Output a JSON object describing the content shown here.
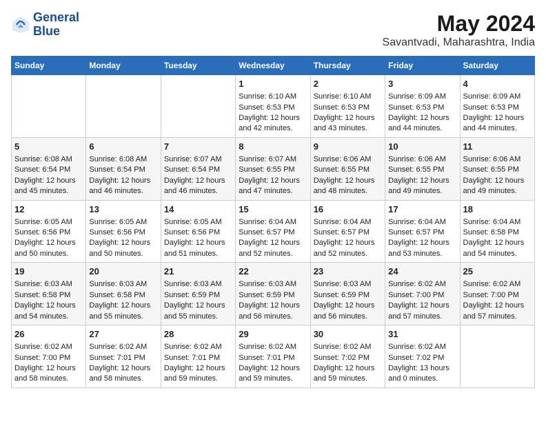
{
  "header": {
    "logo_line1": "General",
    "logo_line2": "Blue",
    "title": "May 2024",
    "subtitle": "Savantvadi, Maharashtra, India"
  },
  "weekdays": [
    "Sunday",
    "Monday",
    "Tuesday",
    "Wednesday",
    "Thursday",
    "Friday",
    "Saturday"
  ],
  "weeks": [
    [
      {
        "day": "",
        "data": ""
      },
      {
        "day": "",
        "data": ""
      },
      {
        "day": "",
        "data": ""
      },
      {
        "day": "1",
        "data": "Sunrise: 6:10 AM\nSunset: 6:53 PM\nDaylight: 12 hours and 42 minutes."
      },
      {
        "day": "2",
        "data": "Sunrise: 6:10 AM\nSunset: 6:53 PM\nDaylight: 12 hours and 43 minutes."
      },
      {
        "day": "3",
        "data": "Sunrise: 6:09 AM\nSunset: 6:53 PM\nDaylight: 12 hours and 44 minutes."
      },
      {
        "day": "4",
        "data": "Sunrise: 6:09 AM\nSunset: 6:53 PM\nDaylight: 12 hours and 44 minutes."
      }
    ],
    [
      {
        "day": "5",
        "data": "Sunrise: 6:08 AM\nSunset: 6:54 PM\nDaylight: 12 hours and 45 minutes."
      },
      {
        "day": "6",
        "data": "Sunrise: 6:08 AM\nSunset: 6:54 PM\nDaylight: 12 hours and 46 minutes."
      },
      {
        "day": "7",
        "data": "Sunrise: 6:07 AM\nSunset: 6:54 PM\nDaylight: 12 hours and 46 minutes."
      },
      {
        "day": "8",
        "data": "Sunrise: 6:07 AM\nSunset: 6:55 PM\nDaylight: 12 hours and 47 minutes."
      },
      {
        "day": "9",
        "data": "Sunrise: 6:06 AM\nSunset: 6:55 PM\nDaylight: 12 hours and 48 minutes."
      },
      {
        "day": "10",
        "data": "Sunrise: 6:06 AM\nSunset: 6:55 PM\nDaylight: 12 hours and 49 minutes."
      },
      {
        "day": "11",
        "data": "Sunrise: 6:06 AM\nSunset: 6:55 PM\nDaylight: 12 hours and 49 minutes."
      }
    ],
    [
      {
        "day": "12",
        "data": "Sunrise: 6:05 AM\nSunset: 6:56 PM\nDaylight: 12 hours and 50 minutes."
      },
      {
        "day": "13",
        "data": "Sunrise: 6:05 AM\nSunset: 6:56 PM\nDaylight: 12 hours and 50 minutes."
      },
      {
        "day": "14",
        "data": "Sunrise: 6:05 AM\nSunset: 6:56 PM\nDaylight: 12 hours and 51 minutes."
      },
      {
        "day": "15",
        "data": "Sunrise: 6:04 AM\nSunset: 6:57 PM\nDaylight: 12 hours and 52 minutes."
      },
      {
        "day": "16",
        "data": "Sunrise: 6:04 AM\nSunset: 6:57 PM\nDaylight: 12 hours and 52 minutes."
      },
      {
        "day": "17",
        "data": "Sunrise: 6:04 AM\nSunset: 6:57 PM\nDaylight: 12 hours and 53 minutes."
      },
      {
        "day": "18",
        "data": "Sunrise: 6:04 AM\nSunset: 6:58 PM\nDaylight: 12 hours and 54 minutes."
      }
    ],
    [
      {
        "day": "19",
        "data": "Sunrise: 6:03 AM\nSunset: 6:58 PM\nDaylight: 12 hours and 54 minutes."
      },
      {
        "day": "20",
        "data": "Sunrise: 6:03 AM\nSunset: 6:58 PM\nDaylight: 12 hours and 55 minutes."
      },
      {
        "day": "21",
        "data": "Sunrise: 6:03 AM\nSunset: 6:59 PM\nDaylight: 12 hours and 55 minutes."
      },
      {
        "day": "22",
        "data": "Sunrise: 6:03 AM\nSunset: 6:59 PM\nDaylight: 12 hours and 56 minutes."
      },
      {
        "day": "23",
        "data": "Sunrise: 6:03 AM\nSunset: 6:59 PM\nDaylight: 12 hours and 56 minutes."
      },
      {
        "day": "24",
        "data": "Sunrise: 6:02 AM\nSunset: 7:00 PM\nDaylight: 12 hours and 57 minutes."
      },
      {
        "day": "25",
        "data": "Sunrise: 6:02 AM\nSunset: 7:00 PM\nDaylight: 12 hours and 57 minutes."
      }
    ],
    [
      {
        "day": "26",
        "data": "Sunrise: 6:02 AM\nSunset: 7:00 PM\nDaylight: 12 hours and 58 minutes."
      },
      {
        "day": "27",
        "data": "Sunrise: 6:02 AM\nSunset: 7:01 PM\nDaylight: 12 hours and 58 minutes."
      },
      {
        "day": "28",
        "data": "Sunrise: 6:02 AM\nSunset: 7:01 PM\nDaylight: 12 hours and 59 minutes."
      },
      {
        "day": "29",
        "data": "Sunrise: 6:02 AM\nSunset: 7:01 PM\nDaylight: 12 hours and 59 minutes."
      },
      {
        "day": "30",
        "data": "Sunrise: 6:02 AM\nSunset: 7:02 PM\nDaylight: 12 hours and 59 minutes."
      },
      {
        "day": "31",
        "data": "Sunrise: 6:02 AM\nSunset: 7:02 PM\nDaylight: 13 hours and 0 minutes."
      },
      {
        "day": "",
        "data": ""
      }
    ]
  ]
}
